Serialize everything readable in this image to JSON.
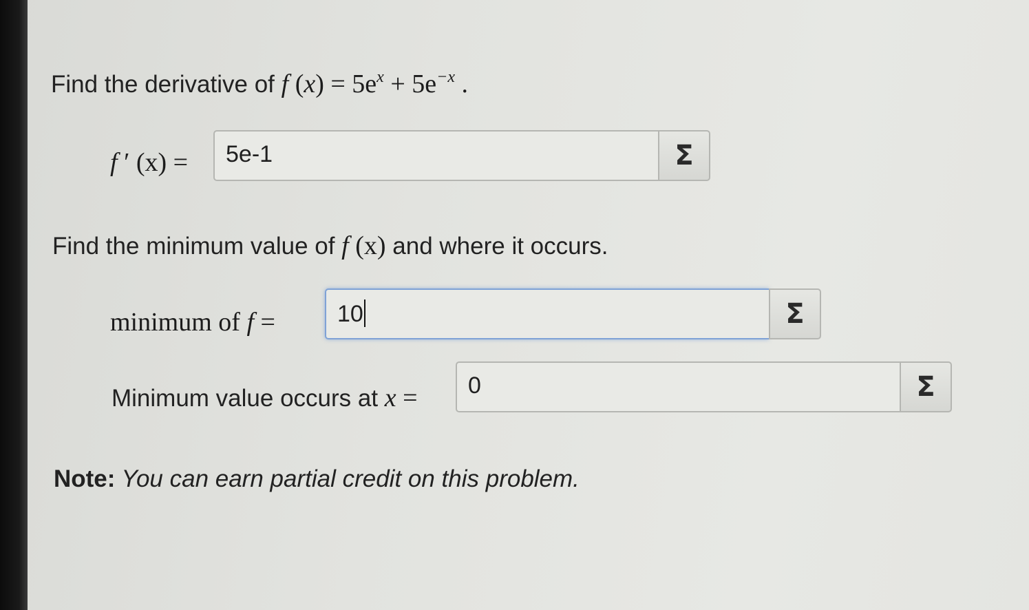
{
  "question1": {
    "lead": "Find the derivative of ",
    "fx": "f",
    "paren_open": " (",
    "x": "x",
    "paren_close": ") = 5e",
    "exp1": "x",
    "plus": " + 5e",
    "exp2": "−x",
    "period": " ."
  },
  "derivative": {
    "label_f": "f",
    "label_rest": " ′ (x) = ",
    "value": "5e-1",
    "sigma": "Σ"
  },
  "question2": {
    "lead": "Find the minimum value of ",
    "fx": "f",
    "paren": " (x)",
    "tail": " and where it occurs."
  },
  "minimum": {
    "label_text": "minimum of ",
    "label_f": "f",
    "label_eq": " = ",
    "value": "10",
    "sigma": "Σ"
  },
  "location": {
    "label_text": "Minimum value occurs at ",
    "label_x": "x",
    "label_eq": " = ",
    "value": "0",
    "sigma": "Σ"
  },
  "note": {
    "bold": "Note:",
    "italic": " You can earn partial credit on this problem."
  },
  "colors": {
    "focus_border": "#7fa2d6",
    "field_border": "#b5b6b2",
    "background": "#e3e4e0"
  }
}
